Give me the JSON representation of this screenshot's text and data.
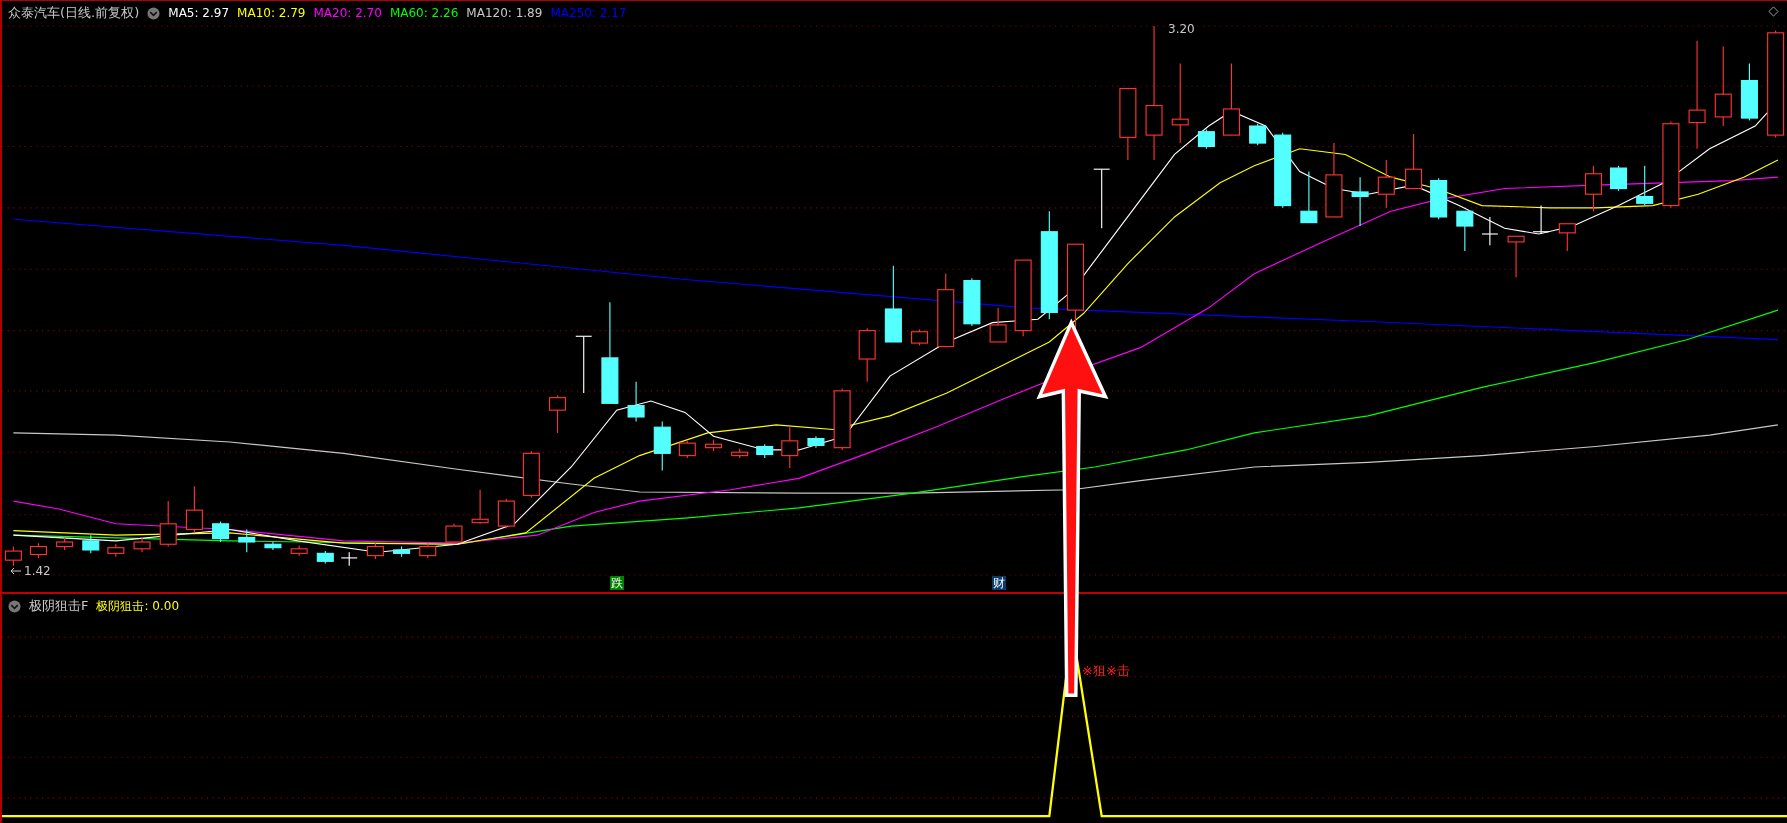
{
  "main_chart": {
    "title": "众泰汽车(日线.前复权)",
    "indicators": [
      {
        "label": "MA5: 2.97",
        "color": "#ffffff"
      },
      {
        "label": "MA10: 2.79",
        "color": "#ffff00"
      },
      {
        "label": "MA20: 2.70",
        "color": "#ff00ff"
      },
      {
        "label": "MA60: 2.26",
        "color": "#00ff00"
      },
      {
        "label": "MA120: 1.89",
        "color": "#c8c8c8"
      },
      {
        "label": "MA250: 2.17",
        "color": "#0000ff"
      }
    ],
    "high_label": "3.20",
    "low_label": "1.42",
    "markers": [
      {
        "text": "跌",
        "color": "#008000"
      },
      {
        "text": "财",
        "color": "#0a3a6a"
      }
    ]
  },
  "sub_chart": {
    "title": "极阴狙击F",
    "value_label": "极阴狙击: 0.00",
    "signal_label": "※狙※击"
  }
}
